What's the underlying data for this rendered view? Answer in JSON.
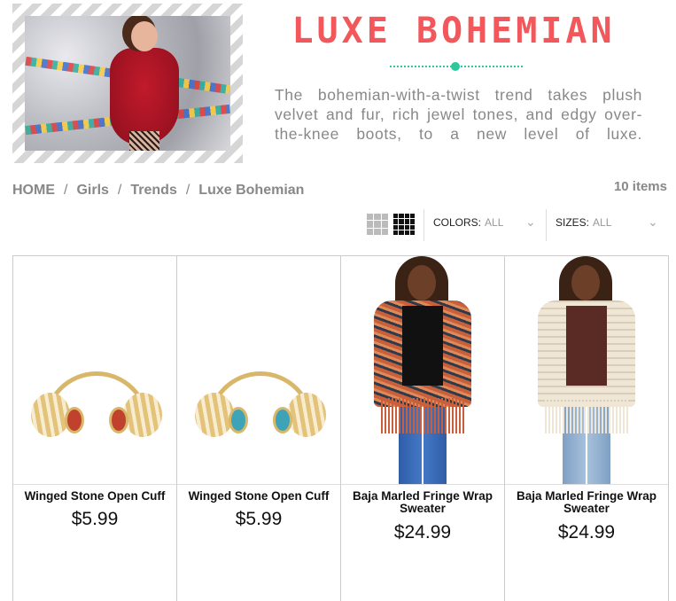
{
  "hero": {
    "title": "LUXE BOHEMIAN",
    "description": "The bohemian-with-a-twist trend takes plush velvet and fur, rich jewel tones, and edgy over-the-knee boots, to a new level of luxe."
  },
  "breadcrumb": [
    {
      "label": "HOME"
    },
    {
      "label": "Girls"
    },
    {
      "label": "Trends"
    },
    {
      "label": "Luxe Bohemian"
    }
  ],
  "item_count": "10 items",
  "filters": {
    "colors_label": "COLORS:",
    "colors_value": "ALL",
    "sizes_label": "SIZES:",
    "sizes_value": "ALL"
  },
  "products": [
    {
      "name": "Winged Stone Open Cuff",
      "price": "$5.99",
      "stone_color": "#c0422c"
    },
    {
      "name": "Winged Stone Open Cuff",
      "price": "$5.99",
      "stone_color": "#3fa3b8"
    },
    {
      "name": "Baja Marled Fringe Wrap Sweater",
      "price": "$24.99",
      "wrap_color": "#c9603b",
      "top_color": "#111111"
    },
    {
      "name": "Baja Marled Fringe Wrap Sweater",
      "price": "$24.99",
      "wrap_color": "#efe6d6",
      "top_color": "#5a2a24"
    }
  ],
  "colors": {
    "accent": "#f2585b",
    "divider": "#2cc79b"
  },
  "icons": {
    "view_small": "grid-3x3-icon",
    "view_large": "grid-4x4-icon",
    "dropdown": "chevron-down-icon"
  }
}
